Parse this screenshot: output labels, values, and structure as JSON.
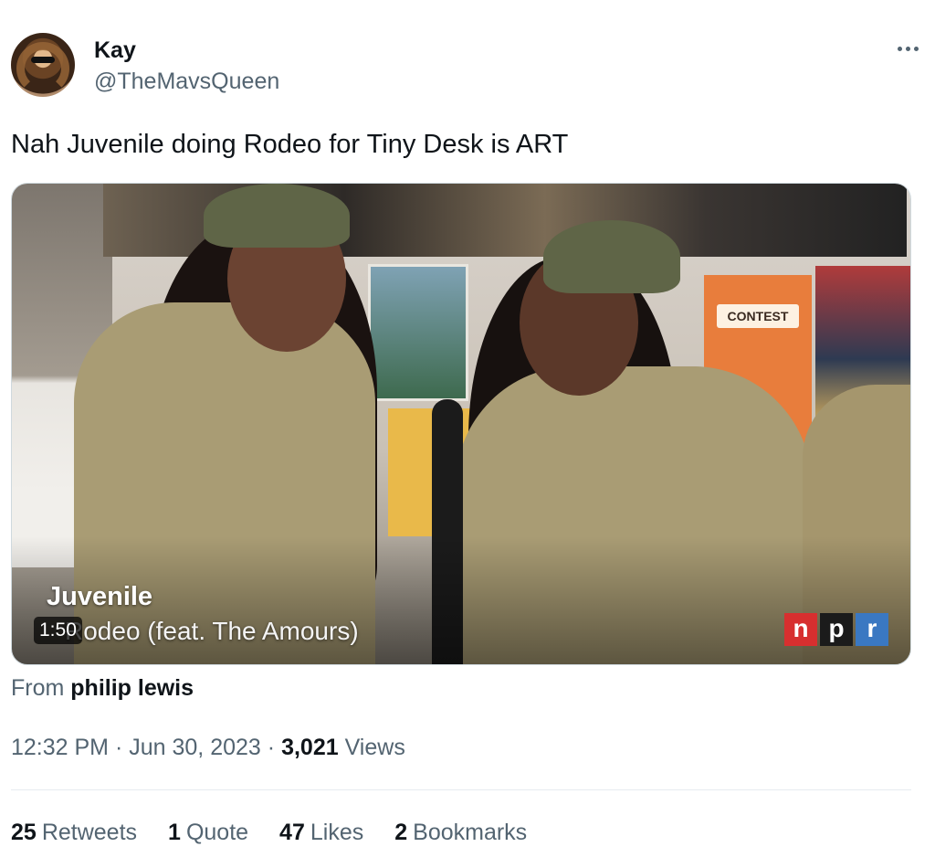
{
  "author": {
    "name": "Kay",
    "handle": "@TheMavsQueen"
  },
  "tweet": {
    "text": "Nah Juvenile doing Rodeo for Tiny Desk is ART"
  },
  "media": {
    "overlay_artist": "Juvenile",
    "overlay_title": "Rodeo (feat. The Amours)",
    "duration": "1:50",
    "poster_text": "CONTEST",
    "logo_letters": [
      "n",
      "p",
      "r"
    ]
  },
  "source": {
    "prefix": "From",
    "name": "philip lewis"
  },
  "meta": {
    "time": "12:32 PM",
    "sep1": "·",
    "date": "Jun 30, 2023",
    "sep2": "·",
    "views_count": "3,021",
    "views_label": "Views"
  },
  "stats": [
    {
      "count": "25",
      "label": "Retweets"
    },
    {
      "count": "1",
      "label": "Quote"
    },
    {
      "count": "47",
      "label": "Likes"
    },
    {
      "count": "2",
      "label": "Bookmarks"
    }
  ]
}
